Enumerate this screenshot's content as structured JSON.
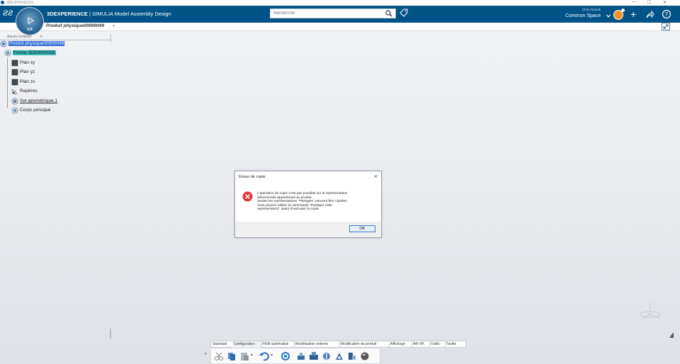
{
  "window": {
    "title": "3DEXPERIENCE"
  },
  "appbar": {
    "brand_bold": "3DEXPERIENCE",
    "brand_rest": " | SIMULIA Model Assembly Design",
    "search_placeholder": "Rechercher",
    "user_name": "Chris Tomnik",
    "space_name": "Common Space",
    "compass_version": "V.R"
  },
  "tabs": {
    "document": "Produit physique00000049"
  },
  "context": {
    "label": "Aucun contexte"
  },
  "tree": [
    {
      "label": "Produit physique00000049",
      "icon": "product-icon",
      "style": "sel-blue"
    },
    {
      "label": "Forme 3DS0000028",
      "icon": "shape-icon",
      "style": "sel-teal"
    },
    {
      "label": "Plan xy",
      "icon": "plane-icon",
      "style": ""
    },
    {
      "label": "Plan yz",
      "icon": "plane-icon",
      "style": ""
    },
    {
      "label": "Plan zx",
      "icon": "plane-icon",
      "style": ""
    },
    {
      "label": "Repères",
      "icon": "axis-icon",
      "style": ""
    },
    {
      "label": "Set géométrique.1",
      "icon": "geoset-icon",
      "style": "underl"
    },
    {
      "label": "Corps principal",
      "icon": "body-icon",
      "style": ""
    }
  ],
  "dialog": {
    "title": "Erreur de copie",
    "message_lines": [
      "L'opération de copie n'est pas possible sur la représentation",
      "sélectionnée appartenant au produit.",
      "Seules les représentations \"Partagée\" peuvent être copiées.",
      "Vous pouvez utiliser la commande \"Partager cette",
      "représentation\" avant d'exécuter la copie."
    ],
    "ok_label": "OK"
  },
  "toolbar": {
    "tabs": [
      "Standard",
      "Configuration",
      "FEM automatisé",
      "Modélisation externe",
      "Modification du produit",
      "Affichage",
      "AR-VR",
      "Outils",
      "Tactile"
    ],
    "active_tab": "Configuration"
  },
  "colors": {
    "appbar": "#005386",
    "error": "#e0363b",
    "selection_blue": "#2e67d6",
    "selection_teal": "#33b8b8"
  }
}
